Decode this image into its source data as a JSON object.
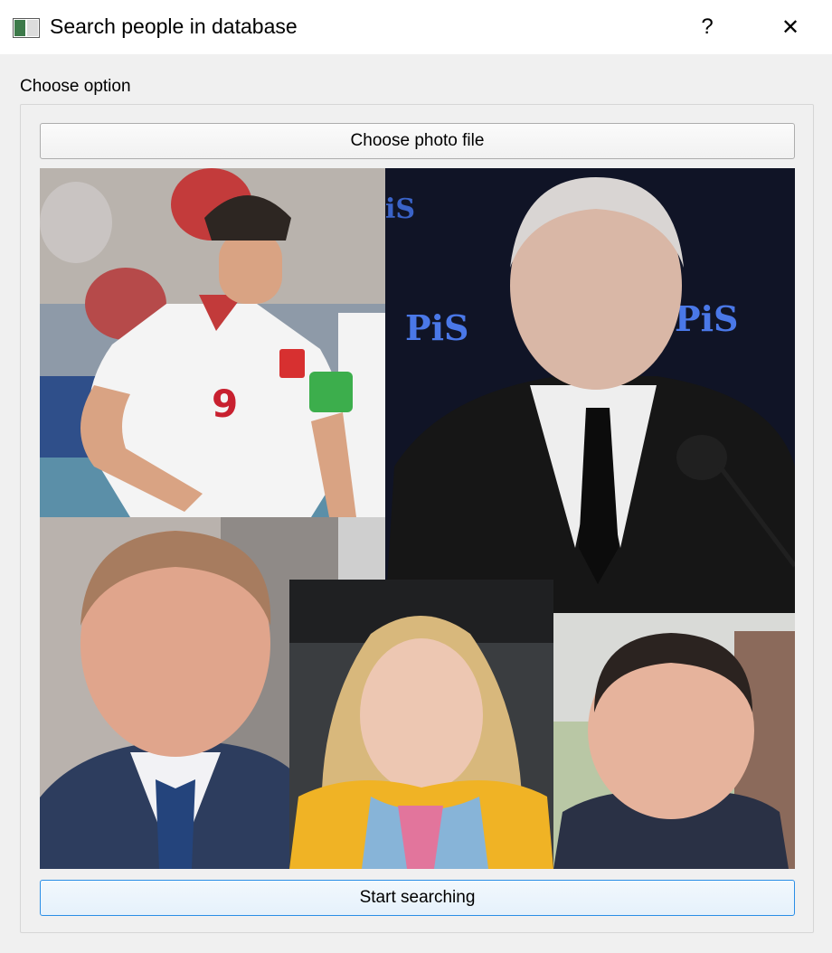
{
  "window": {
    "title": "Search people in database",
    "help_label": "?",
    "close_label": "✕",
    "icon": "app-window-icon"
  },
  "section": {
    "label": "Choose option"
  },
  "buttons": {
    "choose_photo": "Choose photo file",
    "start_search": "Start searching"
  },
  "photos": [
    {
      "name": "footballer-photo",
      "jersey_number": "9"
    },
    {
      "name": "politician-podium-photo",
      "logo_text": "PiS"
    },
    {
      "name": "man-in-suit-photo"
    },
    {
      "name": "blonde-woman-photo"
    },
    {
      "name": "smiling-man-photo"
    }
  ],
  "colors": {
    "accent": "#2a8ee6",
    "window_bg": "#f0f0f0",
    "button_border": "#adadad"
  }
}
